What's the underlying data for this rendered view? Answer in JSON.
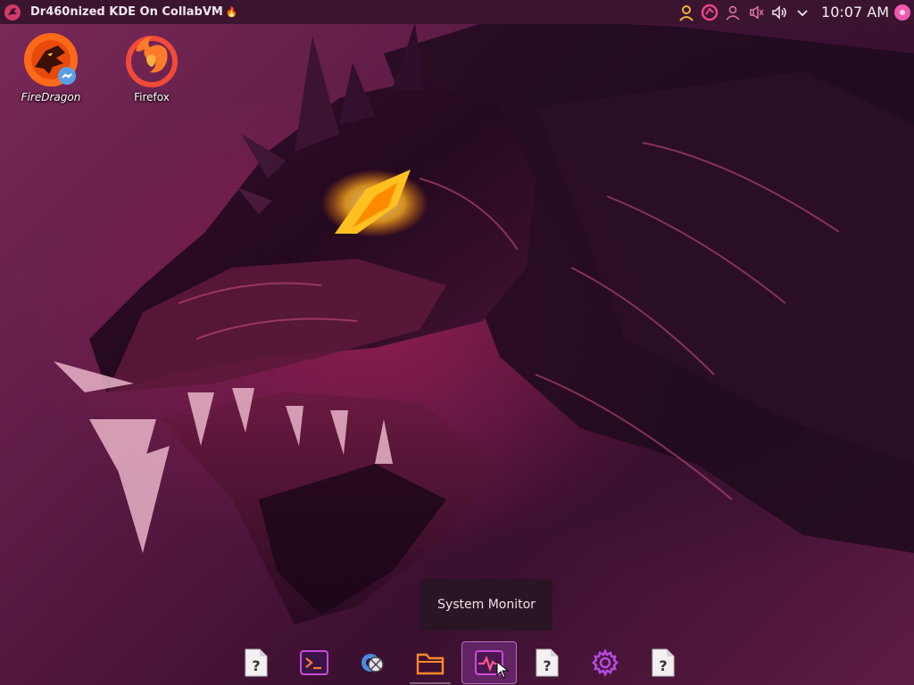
{
  "panel": {
    "window_title": "Dr460nized KDE On CollabVM",
    "title_emoji": "🔥",
    "clock": "10:07 AM"
  },
  "tray_icons": [
    "user-icon",
    "garuda-icon",
    "people-icon",
    "microphone-muted-icon",
    "volume-icon",
    "chevron-down-icon"
  ],
  "desktop_icons": [
    {
      "label": "FireDragon",
      "icon": "firedragon-icon"
    },
    {
      "label": "Firefox",
      "icon": "firefox-icon"
    }
  ],
  "tooltip": {
    "text": "System Monitor"
  },
  "dock": {
    "items": [
      {
        "icon": "unknown-app-icon"
      },
      {
        "icon": "terminal-icon"
      },
      {
        "icon": "system-settings-tool-icon"
      },
      {
        "icon": "file-manager-icon"
      },
      {
        "icon": "system-monitor-icon"
      },
      {
        "icon": "unknown-app-icon"
      },
      {
        "icon": "settings-gear-icon"
      },
      {
        "icon": "unknown-app-icon"
      }
    ],
    "active": "System Monitor"
  },
  "colors": {
    "panel_bg": "#3b1530",
    "accent": "#c03ad6",
    "firedragon": "#ff6a1a",
    "tooltip_bg": "#28162a"
  }
}
